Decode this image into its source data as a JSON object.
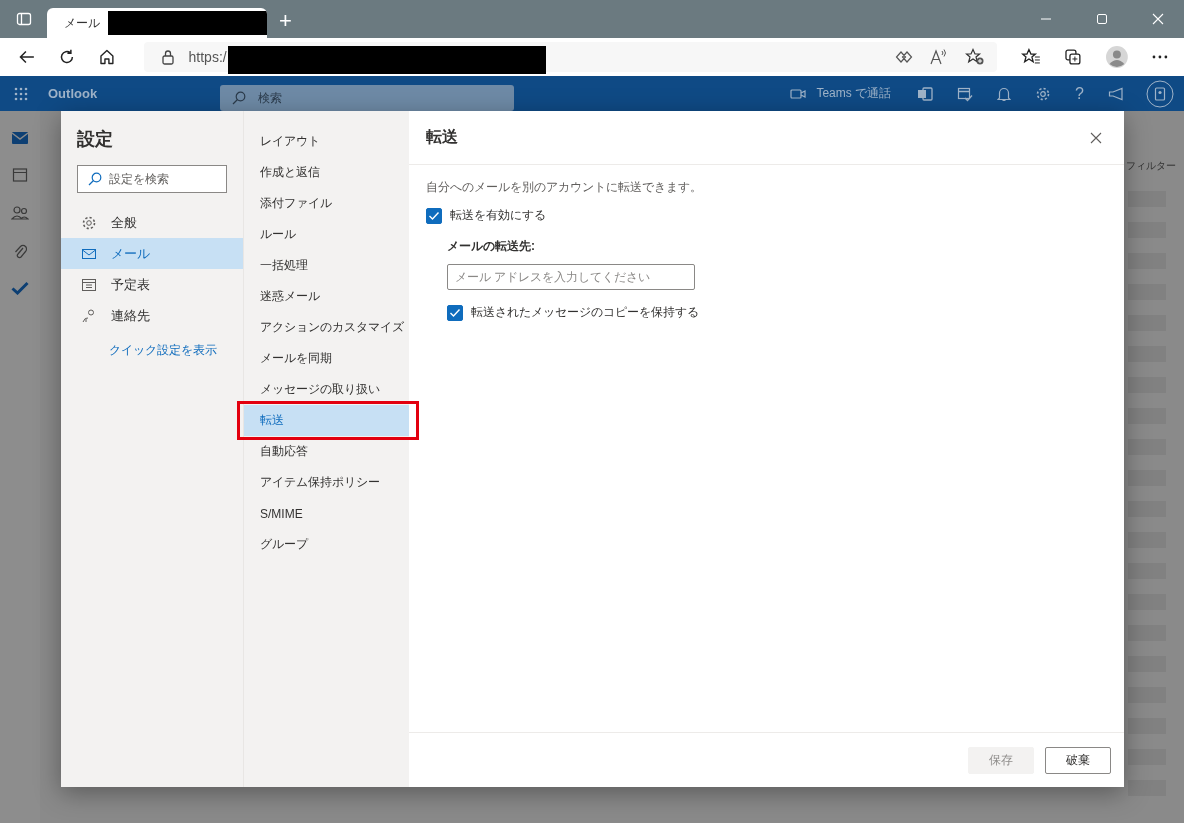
{
  "browser": {
    "tab_title": "メール",
    "new_tab": "+",
    "url": "https:/"
  },
  "outlook": {
    "app_name": "Outlook",
    "search_placeholder": "検索",
    "teams_call": "Teams で通話",
    "help": "?"
  },
  "background": {
    "filter_label": "フィルター"
  },
  "settings": {
    "title": "設定",
    "search_placeholder": "設定を検索",
    "categories": [
      {
        "kind": "gear",
        "label": "全般",
        "selected": false
      },
      {
        "kind": "mail",
        "label": "メール",
        "selected": true
      },
      {
        "kind": "calendar",
        "label": "予定表",
        "selected": false
      },
      {
        "kind": "people",
        "label": "連絡先",
        "selected": false
      }
    ],
    "quick_settings_link": "クイック設定を表示",
    "subnav": [
      {
        "label": "レイアウト",
        "selected": false,
        "highlighted": false
      },
      {
        "label": "作成と返信",
        "selected": false,
        "highlighted": false
      },
      {
        "label": "添付ファイル",
        "selected": false,
        "highlighted": false
      },
      {
        "label": "ルール",
        "selected": false,
        "highlighted": false
      },
      {
        "label": "一括処理",
        "selected": false,
        "highlighted": false
      },
      {
        "label": "迷惑メール",
        "selected": false,
        "highlighted": false
      },
      {
        "label": "アクションのカスタマイズ",
        "selected": false,
        "highlighted": false
      },
      {
        "label": "メールを同期",
        "selected": false,
        "highlighted": false
      },
      {
        "label": "メッセージの取り扱い",
        "selected": false,
        "highlighted": false
      },
      {
        "label": "転送",
        "selected": true,
        "highlighted": true
      },
      {
        "label": "自動応答",
        "selected": false,
        "highlighted": false
      },
      {
        "label": "アイテム保持ポリシー",
        "selected": false,
        "highlighted": false
      },
      {
        "label": "S/MIME",
        "selected": false,
        "highlighted": false
      },
      {
        "label": "グループ",
        "selected": false,
        "highlighted": false
      }
    ],
    "panel": {
      "title": "転送",
      "description": "自分へのメールを別のアカウントに転送できます。",
      "enable_forwarding": {
        "label": "転送を有効にする",
        "checked": true
      },
      "address_label": "メールの転送先:",
      "address_placeholder": "メール アドレスを入力してください",
      "keep_copy": {
        "label": "転送されたメッセージのコピーを保持する",
        "checked": true
      }
    },
    "buttons": [
      {
        "label": "保存",
        "disabled": true
      },
      {
        "label": "破棄",
        "disabled": false
      }
    ]
  }
}
